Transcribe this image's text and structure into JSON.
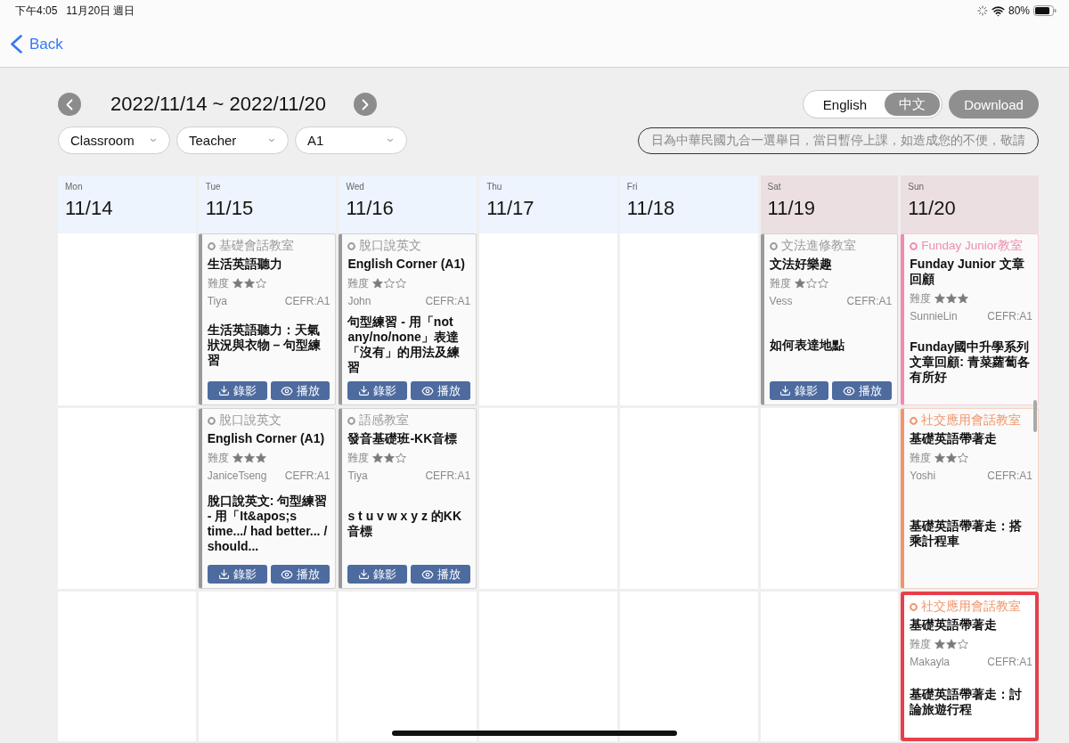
{
  "status_bar": {
    "time": "下午4:05",
    "date": "11月20日 週日",
    "battery": "80%"
  },
  "nav": {
    "back": "Back"
  },
  "week": {
    "range": "2022/11/14 ~ 2022/11/20"
  },
  "language_toggle": [
    {
      "label": "English",
      "selected": false
    },
    {
      "label": "中文",
      "selected": true
    }
  ],
  "download": "Download",
  "filters": [
    {
      "label": "Classroom"
    },
    {
      "label": "Teacher"
    },
    {
      "label": "A1"
    }
  ],
  "notice": "日為中華民國九合一選舉日，當日暫停上課，如造成您的不便，敬請",
  "days": [
    {
      "weekday": "Mon",
      "date": "11/14",
      "weekend": false
    },
    {
      "weekday": "Tue",
      "date": "11/15",
      "weekend": false
    },
    {
      "weekday": "Wed",
      "date": "11/16",
      "weekend": false
    },
    {
      "weekday": "Thu",
      "date": "11/17",
      "weekend": false
    },
    {
      "weekday": "Fri",
      "date": "11/18",
      "weekend": false
    },
    {
      "weekday": "Sat",
      "date": "11/19",
      "weekend": true
    },
    {
      "weekday": "Sun",
      "date": "11/20",
      "weekend": true
    }
  ],
  "rows": [
    {
      "cells": [
        {
          "kind": "empty"
        },
        {
          "kind": "lesson",
          "category": "基礎會話教室",
          "color": "#9a9a9a",
          "title": "生活英語聽力",
          "difficulty_label": "難度",
          "stars": 2,
          "teacher": "Tiya",
          "cefr": "CEFR:A1",
          "description": "生活英語聽力：天氣狀況與衣物 – 句型練習",
          "highlighted": false,
          "buttons": [
            {
              "kind": "record",
              "label": "錄影"
            },
            {
              "kind": "play",
              "label": "播放"
            }
          ]
        },
        {
          "kind": "lesson",
          "category": "脫口說英文",
          "color": "#9a9a9a",
          "title": "English Corner (A1)",
          "difficulty_label": "難度",
          "stars": 1,
          "teacher": "John",
          "cefr": "CEFR:A1",
          "description": "句型練習 - 用「not any/no/none」表達「沒有」的用法及練習",
          "highlighted": false,
          "buttons": [
            {
              "kind": "record",
              "label": "錄影"
            },
            {
              "kind": "play",
              "label": "播放"
            }
          ]
        },
        {
          "kind": "empty"
        },
        {
          "kind": "empty"
        },
        {
          "kind": "lesson",
          "category": "文法進修教室",
          "color": "#9a9a9a",
          "title": "文法好樂趣",
          "difficulty_label": "難度",
          "stars": 1,
          "teacher": "Vess",
          "cefr": "CEFR:A1",
          "description": "如何表達地點",
          "highlighted": false,
          "buttons": [
            {
              "kind": "record",
              "label": "錄影"
            },
            {
              "kind": "play",
              "label": "播放"
            }
          ]
        },
        {
          "kind": "lesson",
          "category": "Funday Junior教室",
          "color": "#f08cab",
          "title": "Funday Junior 文章回顧",
          "difficulty_label": "難度",
          "stars": 3,
          "teacher": "SunnieLin",
          "cefr": "CEFR:A1",
          "description": "Funday國中升學系列文章回顧: 青菜蘿蔔各有所好",
          "highlighted": false
        }
      ]
    },
    {
      "cells": [
        {
          "kind": "empty"
        },
        {
          "kind": "lesson",
          "category": "脫口說英文",
          "color": "#9a9a9a",
          "title": "English Corner (A1)",
          "difficulty_label": "難度",
          "stars": 3,
          "teacher": "JaniceTseng",
          "cefr": "CEFR:A1",
          "description": "脫口說英文: 句型練習 - 用「It&apos;s time.../ had better... / should...",
          "highlighted": false,
          "buttons": [
            {
              "kind": "record",
              "label": "錄影"
            },
            {
              "kind": "play",
              "label": "播放"
            }
          ]
        },
        {
          "kind": "lesson",
          "category": "語感教室",
          "color": "#9a9a9a",
          "title": "發音基礎班-KK音標",
          "difficulty_label": "難度",
          "stars": 2,
          "teacher": "Tiya",
          "cefr": "CEFR:A1",
          "description": "s t u v w x y z 的KK音標",
          "highlighted": false,
          "buttons": [
            {
              "kind": "record",
              "label": "錄影"
            },
            {
              "kind": "play",
              "label": "播放"
            }
          ]
        },
        {
          "kind": "empty"
        },
        {
          "kind": "empty"
        },
        {
          "kind": "empty"
        },
        {
          "kind": "lesson",
          "category": "社交應用會話教室",
          "color": "#f0956a",
          "title": "基礎英語帶著走",
          "difficulty_label": "難度",
          "stars": 2,
          "teacher": "Yoshi",
          "cefr": "CEFR:A1",
          "description": "基礎英語帶著走：搭乘計程車",
          "highlighted": false
        }
      ]
    },
    {
      "cells": [
        {
          "kind": "empty"
        },
        {
          "kind": "empty"
        },
        {
          "kind": "empty"
        },
        {
          "kind": "empty"
        },
        {
          "kind": "empty"
        },
        {
          "kind": "empty"
        },
        {
          "kind": "lesson",
          "category": "社交應用會話教室",
          "color": "#f0956a",
          "title": "基礎英語帶著走",
          "difficulty_label": "難度",
          "stars": 2,
          "teacher": "Makayla",
          "cefr": "CEFR:A1",
          "description": "基礎英語帶著走：討論旅遊行程",
          "highlighted": true
        }
      ]
    }
  ]
}
